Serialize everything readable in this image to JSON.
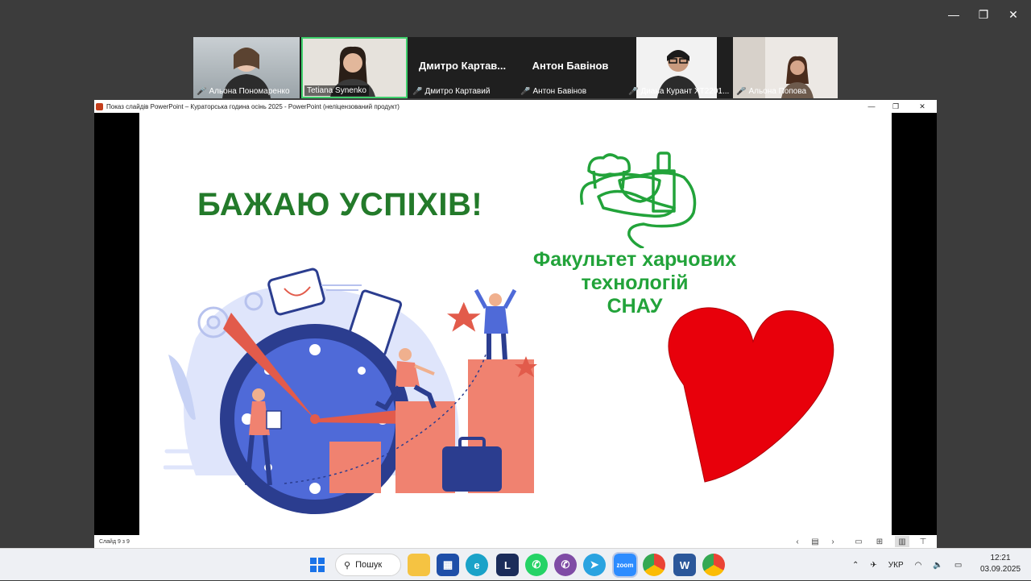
{
  "window_controls": {
    "minimize": "—",
    "maximize": "❐",
    "close": "✕"
  },
  "participants": [
    {
      "name": "Альона Пономаренко",
      "muted": true
    },
    {
      "name": "Tetiana Synenko",
      "muted": false,
      "active_speaker": true
    },
    {
      "name": "Дмитро Картавий",
      "display": "Дмитро  Картав...",
      "muted": true
    },
    {
      "name": "Антон Бавінов",
      "display": "Антон Бавінов",
      "muted": true
    },
    {
      "name": "Диана Курант ХТ2201...",
      "muted": true
    },
    {
      "name": "Альона Попова",
      "muted": true
    }
  ],
  "powerpoint": {
    "title": "Показ слайдів PowerPoint  –  Кураторська година осінь 2025 - PowerPoint (неліцензований продукт)",
    "slide": {
      "headline": "БАЖАЮ УСПІХІВ!",
      "faculty_line1": "Факультет харчових",
      "faculty_line2": "технологій",
      "faculty_line3": "СНАУ"
    },
    "status_text": "Слайд 9 з 9"
  },
  "taskbar": {
    "search_label": "Пошук",
    "language": "УКР",
    "time": "12:21",
    "date": "03.09.2025",
    "apps": [
      "file-explorer",
      "microsoft-store",
      "edge",
      "lingvo",
      "whatsapp",
      "viber",
      "telegram",
      "zoom",
      "chrome",
      "word",
      "chrome-profile"
    ]
  },
  "colors": {
    "headline": "#237a2a",
    "faculty_text": "#22a33a",
    "heart": "#e8000b",
    "active_speaker_border": "#3ecf6b"
  }
}
